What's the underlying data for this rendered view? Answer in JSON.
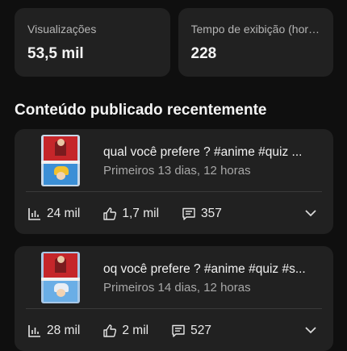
{
  "stats": [
    {
      "label": "Visualizações",
      "value": "53,5 mil"
    },
    {
      "label": "Tempo de exibição (hor…",
      "value": "228"
    }
  ],
  "section": {
    "title": "Conteúdo publicado recentemente"
  },
  "videos": [
    {
      "title": "qual você prefere ? #anime #quiz ...",
      "subtitle": "Primeiros 13 dias, 12 horas",
      "views": "24 mil",
      "likes": "1,7 mil",
      "comments": "357"
    },
    {
      "title": "oq você prefere ? #anime #quiz #s...",
      "subtitle": "Primeiros 14 dias, 12 horas",
      "views": "28 mil",
      "likes": "2 mil",
      "comments": "527"
    }
  ],
  "icons": {
    "views": "bar-chart-icon",
    "likes": "thumbs-up-icon",
    "comments": "comment-icon",
    "expand": "chevron-down-icon"
  }
}
